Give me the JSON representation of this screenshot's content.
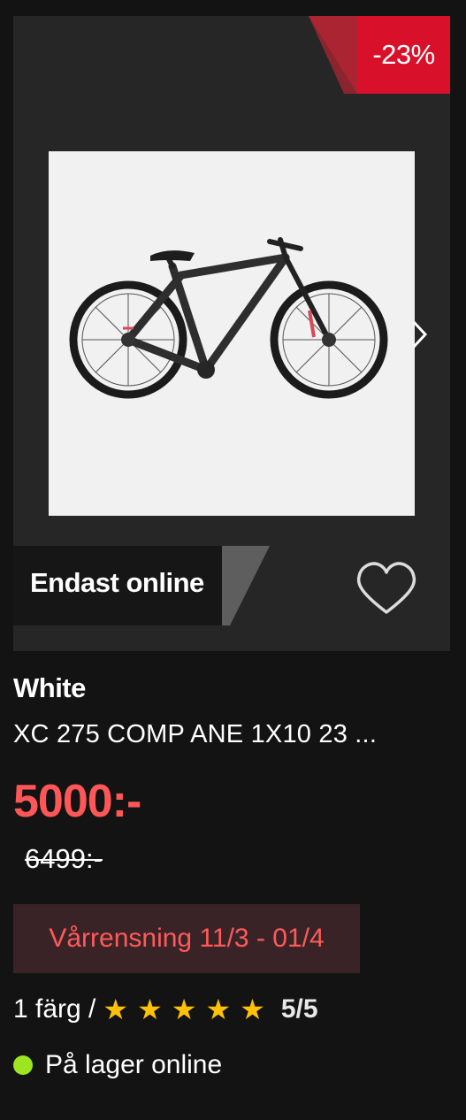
{
  "product": {
    "discount_badge": "-23%",
    "online_badge": "Endast online",
    "brand": "White",
    "model": "XC 275 COMP ANE 1X10 23 ...",
    "price": "5000:-",
    "old_price": "6499:-",
    "campaign": "Vårrensning 11/3 - 01/4",
    "colors": "1 färg /",
    "rating_stars": 5,
    "rating_text": "5/5",
    "stock": "På lager online"
  },
  "colors": {
    "background": "#131313",
    "panel": "#262626",
    "discount_red": "#d8102a",
    "price_red": "#ff5757",
    "campaign_bg": "#3a2326",
    "star": "#ffc107",
    "stock_green": "#9de520"
  },
  "icons": {
    "next": "chevron-right-icon",
    "wishlist": "heart-outline-icon",
    "star": "star-icon",
    "stock": "status-dot-icon"
  }
}
